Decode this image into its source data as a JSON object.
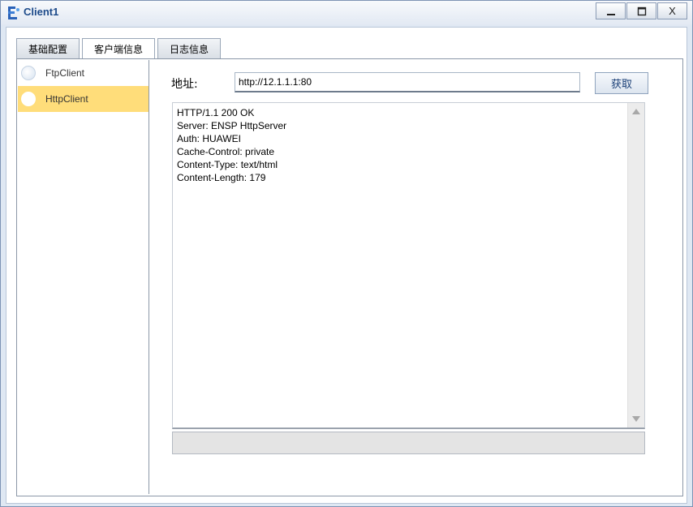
{
  "window": {
    "title": "Client1",
    "app_icon": "network-client-icon",
    "controls": {
      "minimize": "—",
      "maximize": "☐",
      "close": "X"
    }
  },
  "tabs": [
    {
      "label": "基础配置",
      "active": false
    },
    {
      "label": "客户端信息",
      "active": true
    },
    {
      "label": "日志信息",
      "active": false
    }
  ],
  "client_list": [
    {
      "label": "FtpClient",
      "selected": false
    },
    {
      "label": "HttpClient",
      "selected": true
    }
  ],
  "address": {
    "label": "地址:",
    "value": "http://12.1.1.1:80"
  },
  "fetch_button": {
    "label": "获取"
  },
  "output": {
    "lines": [
      "HTTP/1.1 200 OK",
      "Server: ENSP HttpServer",
      "Auth: HUAWEI",
      "Cache-Control: private",
      "Content-Type: text/html",
      "Content-Length: 179"
    ]
  },
  "colors": {
    "selected_item": "#ffdd7a",
    "title_text": "#1c4a8a"
  }
}
